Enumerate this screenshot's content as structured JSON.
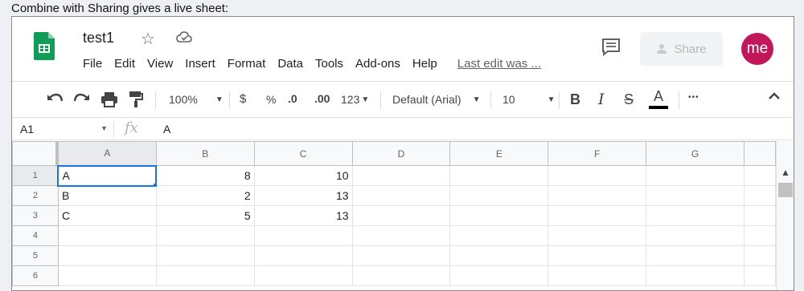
{
  "caption": "Combine with Sharing gives a live sheet:",
  "doc": {
    "title": "test1"
  },
  "menu": [
    "File",
    "Edit",
    "View",
    "Insert",
    "Format",
    "Data",
    "Tools",
    "Add-ons",
    "Help"
  ],
  "last_edit": "Last edit was ...",
  "share_label": "Share",
  "avatar_initials": "me",
  "toolbar": {
    "zoom": "100%",
    "currency": "$",
    "percent": "%",
    "dec_decrease": ".0",
    "dec_increase": ".00",
    "more_formats": "123",
    "font": "Default (Arial)",
    "font_size": "10",
    "bold": "B",
    "italic": "I",
    "strike": "S",
    "text_color": "A",
    "more": "•••"
  },
  "formula_bar": {
    "cell_ref": "A1",
    "fx": "fx",
    "value": "A"
  },
  "columns": [
    "A",
    "B",
    "C",
    "D",
    "E",
    "F",
    "G"
  ],
  "rows": [
    {
      "n": "1",
      "a": "A",
      "b": "8",
      "c": "10"
    },
    {
      "n": "2",
      "a": "B",
      "b": "2",
      "c": "13"
    },
    {
      "n": "3",
      "a": "C",
      "b": "5",
      "c": "13"
    },
    {
      "n": "4",
      "a": "",
      "b": "",
      "c": ""
    },
    {
      "n": "5",
      "a": "",
      "b": "",
      "c": ""
    },
    {
      "n": "6",
      "a": "",
      "b": "",
      "c": ""
    }
  ],
  "colors": {
    "brand_green": "#0f9d58",
    "avatar": "#c2185b",
    "selection": "#1a73e8"
  }
}
